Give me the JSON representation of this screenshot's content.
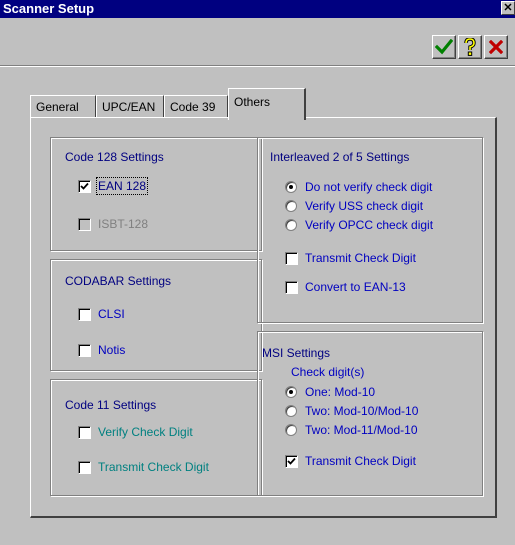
{
  "window": {
    "title": "Scanner Setup",
    "close_glyph": "✕"
  },
  "toolbar": {
    "buttons": [
      {
        "name": "ok-check-icon",
        "color": "#008000"
      },
      {
        "name": "help-question-icon",
        "color": "#808000"
      },
      {
        "name": "cancel-x-icon",
        "color": "#c00000"
      }
    ]
  },
  "tabs": [
    {
      "label": "General"
    },
    {
      "label": "UPC/EAN"
    },
    {
      "label": "Code 39"
    },
    {
      "label": "Others",
      "active": true
    }
  ],
  "code128": {
    "title": "Code 128 Settings",
    "ean128": {
      "label": "EAN 128",
      "checked": true
    },
    "isbt128": {
      "label": "ISBT-128",
      "checked": false,
      "disabled": true
    }
  },
  "codabar": {
    "title": "CODABAR Settings",
    "clsi": {
      "label": "CLSI",
      "checked": false
    },
    "notis": {
      "label": "Notis",
      "checked": false
    }
  },
  "code11": {
    "title": "Code 11 Settings",
    "verify": {
      "label": "Verify Check Digit",
      "checked": false
    },
    "transmit": {
      "label": "Transmit Check Digit",
      "checked": false
    }
  },
  "i2of5": {
    "title": "Interleaved 2 of 5 Settings",
    "options": [
      {
        "label": "Do not verify check digit",
        "selected": true
      },
      {
        "label": "Verify USS check digit",
        "selected": false
      },
      {
        "label": "Verify OPCC check digit",
        "selected": false
      }
    ],
    "transmit": {
      "label": "Transmit Check Digit",
      "checked": false
    },
    "convert": {
      "label": "Convert to EAN-13",
      "checked": false
    }
  },
  "msi": {
    "title": "MSI Settings",
    "subtitle": "Check digit(s)",
    "options": [
      {
        "label": "One: Mod-10",
        "selected": true
      },
      {
        "label": "Two: Mod-10/Mod-10",
        "selected": false
      },
      {
        "label": "Two: Mod-11/Mod-10",
        "selected": false
      }
    ],
    "transmit": {
      "label": "Transmit Check Digit",
      "checked": true
    }
  }
}
